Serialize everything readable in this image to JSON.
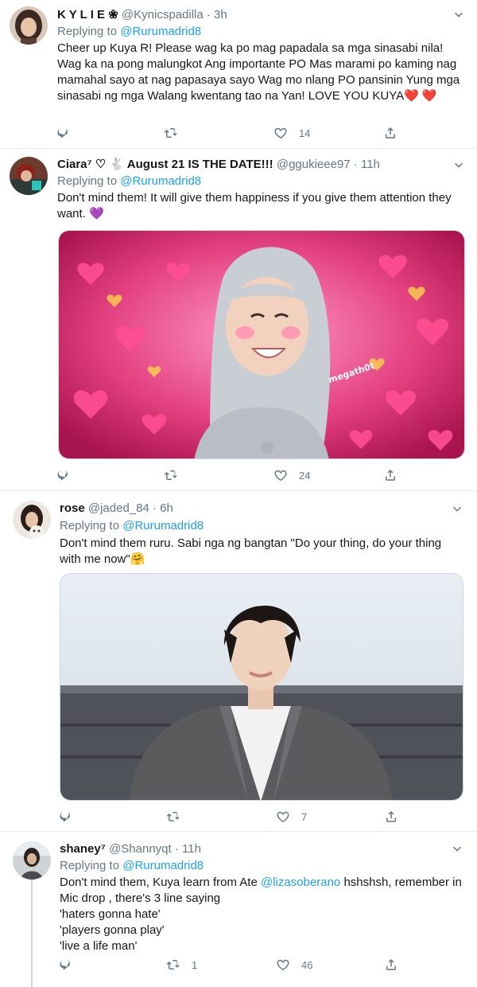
{
  "icons": {
    "reply": "reply-icon",
    "retweet": "retweet-icon",
    "like": "heart-icon",
    "share": "share-icon",
    "more": "chevron-down-icon"
  },
  "colors": {
    "link": "#1da1f2",
    "muted": "#657786",
    "text": "#14171a",
    "divider": "#e6ecf0"
  },
  "tweets": [
    {
      "name": "K Y L I E ❀",
      "handle": "@Kynicspadilla · 3h",
      "replying_prefix": "Replying to ",
      "replying_to": "@Rurumadrid8",
      "text": "Cheer up Kuya R! Please wag ka po mag papadala sa mga sinasabi nila! Wag ka na pong malungkot Ang importante PO Mas marami po kaming nag mamahal sayo at nag papasaya sayo Wag mo nlang PO pansinin Yung mga sinasabi ng mga Walang kwentang tao na Yan! LOVE YOU KUYA❤️ ❤️",
      "retweets": "",
      "likes": "14"
    },
    {
      "name": "Ciara⁷ ♡ 🐇 August 21 IS THE DATE!!!",
      "handle": "@ggukieee97 · 11h",
      "replying_prefix": "Replying to ",
      "replying_to": "@Rurumadrid8",
      "text": "Don't mind them! It will give them happiness if you give them attention they want. 💜",
      "watermark": "megath0t",
      "retweets": "",
      "likes": "24"
    },
    {
      "name": "rose",
      "handle": "@jaded_84 · 6h",
      "replying_prefix": "Replying to ",
      "replying_to": "@Rurumadrid8",
      "text": "Don't mind them ruru. Sabi nga ng bangtan \"Do your thing, do your thing with me now\"🤗",
      "retweets": "",
      "likes": "7"
    },
    {
      "name": "shaney⁷",
      "handle": "@Shannyqt · 11h",
      "replying_prefix": "Replying to ",
      "replying_to": "@Rurumadrid8",
      "text_1": "Don't mind them, Kuya learn from Ate ",
      "mention": "@lizasoberano",
      "text_2": " hshshsh, remember in Mic drop , there's 3 line saying",
      "line_1": "'haters gonna hate'",
      "line_2": "'players gonna play'",
      "line_3": "'live a life man'",
      "retweets": "1",
      "likes": "46"
    }
  ]
}
